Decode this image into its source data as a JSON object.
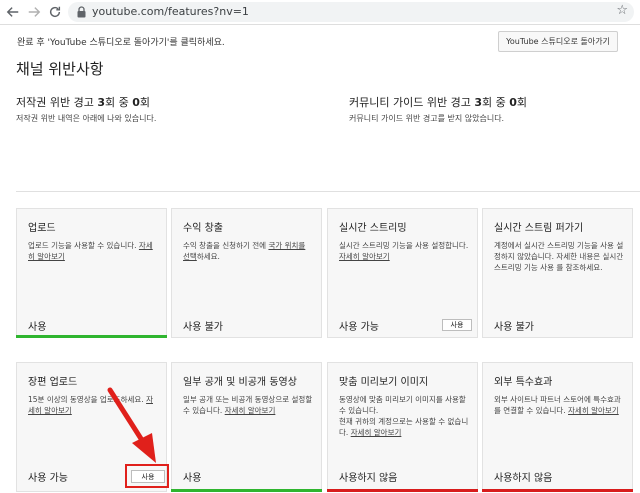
{
  "browser": {
    "url": "youtube.com/features?nv=1",
    "icons": [
      "back-arrow-icon",
      "forward-arrow-icon",
      "reload-icon",
      "lock-icon",
      "star-icon"
    ]
  },
  "notice": {
    "text": "완료 후 'YouTube 스튜디오로 돌아가기'를 클릭하세요.",
    "button": "YouTube 스튜디오로 돌아가기"
  },
  "page_title": "채널 위반사항",
  "copyright": {
    "title_pre": "저작권 위반 경고 ",
    "count": "3",
    "title_mid": "회 중 ",
    "current": "0",
    "title_post": "회",
    "desc": "저작권 위반 내역은 아래에 나와 있습니다."
  },
  "community": {
    "title_pre": "커뮤니티 가이드 위반 경고 ",
    "count": "3",
    "title_mid": "회 중 ",
    "current": "0",
    "title_post": "회",
    "desc": "커뮤니티 가이드 위반 경고를 받지 않았습니다."
  },
  "cards": {
    "upload": {
      "title": "업로드",
      "desc": "업로드 기능을 사용할 수 있습니다.",
      "link": "자세히 알아보기",
      "status": "사용"
    },
    "monetization": {
      "title": "수익 창출",
      "desc_pre": "수익 창출을 신청하기 전에 ",
      "link": "국가 위치를 선택",
      "desc_post": "하세요.",
      "status": "사용 불가"
    },
    "live": {
      "title": "실시간 스트리밍",
      "desc": "실시간 스트리밍 기능을 사용 설정합니다.",
      "link": "자세히 알아보기",
      "status": "사용 가능",
      "button": "사용"
    },
    "live_embed": {
      "title": "실시간 스트림 퍼가기",
      "desc": "계정에서 실시간 스트리밍 기능을 사용 설정하지 않았습니다. 자세한 내용은 실시간 스트리밍 기능 사용 를 참조하세요.",
      "status": "사용 불가"
    },
    "long_upload": {
      "title": "장편 업로드",
      "desc": "15분 이상의 동영상을 업로드하세요.",
      "link": "자세히 알아보기",
      "status": "사용 가능",
      "button": "사용"
    },
    "unlisted": {
      "title": "일부 공개 및 비공개 동영상",
      "desc": "일부 공개 또는 비공개 동영상으로 설정할 수 있습니다.",
      "link": "자세히 알아보기",
      "status": "사용"
    },
    "thumbnails": {
      "title": "맞춤 미리보기 이미지",
      "desc1": "동영상에 맞춤 미리보기 이미지를 사용할 수 있습니다.",
      "desc2": "현재 귀하의 계정으로는 사용할 수 없습니다.",
      "link": "자세히 알아보기",
      "status": "사용하지 않음"
    },
    "annotations": {
      "title": "외부 특수효과",
      "desc": "외부 사이트나 파트너 스토어에 특수효과를 연결할 수 있습니다.",
      "link": "자세히 알아보기",
      "status": "사용하지 않음"
    }
  },
  "colors": {
    "green": "#2fb52f",
    "red": "#d81c1c",
    "highlight": "#e0201b"
  }
}
